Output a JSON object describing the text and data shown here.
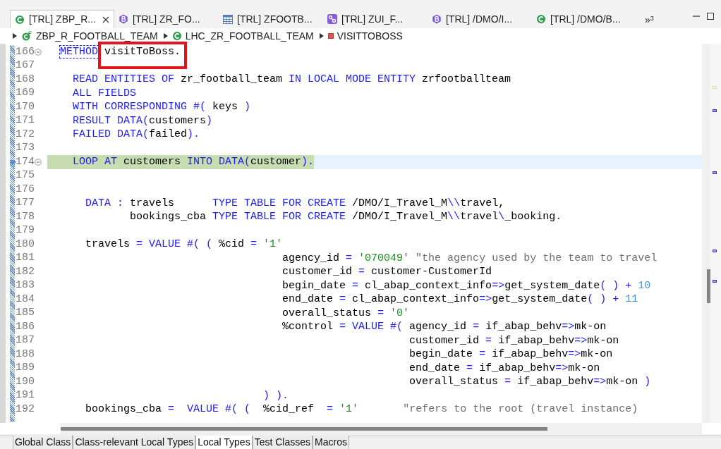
{
  "editor_tabs": [
    {
      "kind": "class",
      "label": "[TRL] ZBP_R...",
      "selected": true
    },
    {
      "kind": "behavior",
      "label": "[TRL] ZR_FO...",
      "selected": false
    },
    {
      "kind": "table",
      "label": "[TRL] ZFOOTB...",
      "selected": false
    },
    {
      "kind": "service",
      "label": "[TRL] ZUI_F...",
      "selected": false
    },
    {
      "kind": "behavior",
      "label": "[TRL] /DMO/I...",
      "selected": false
    },
    {
      "kind": "class",
      "label": "[TRL] /DMO/B...",
      "selected": false
    }
  ],
  "overflow": {
    "symbol": "»",
    "count": "3"
  },
  "breadcrumb": [
    {
      "kind": "global-class",
      "label": "ZBP_R_FOOTBALL_TEAM"
    },
    {
      "kind": "class",
      "label": "LHC_ZR_FOOTBALL_TEAM"
    },
    {
      "kind": "method",
      "label": "VISITTOBOSS"
    }
  ],
  "code_lines": [
    {
      "number": "166",
      "foldable": true,
      "current": false,
      "tokens": [
        {
          "kind": "matched",
          "text": "METHOD"
        },
        {
          "kind": "text",
          "text": " visitToBoss."
        }
      ]
    },
    {
      "number": "167",
      "foldable": false,
      "current": false
    },
    {
      "number": "168",
      "foldable": false,
      "current": false,
      "tokens": [
        {
          "kind": "keyword",
          "text": "    READ ENTITIES OF"
        },
        {
          "kind": "text",
          "text": " zr_football_team "
        },
        {
          "kind": "keyword",
          "text": "IN LOCAL MODE ENTITY"
        },
        {
          "kind": "text",
          "text": " zrfootballteam"
        }
      ]
    },
    {
      "number": "169",
      "foldable": false,
      "current": false,
      "tokens": [
        {
          "kind": "keyword",
          "text": "    ALL FIELDS"
        }
      ]
    },
    {
      "number": "170",
      "foldable": false,
      "current": false,
      "tokens": [
        {
          "kind": "keyword",
          "text": "    WITH CORRESPONDING #("
        },
        {
          "kind": "text",
          "text": " keys "
        },
        {
          "kind": "keyword",
          "text": ")"
        }
      ]
    },
    {
      "number": "171",
      "foldable": false,
      "current": false,
      "tokens": [
        {
          "kind": "keyword",
          "text": "    RESULT DATA("
        },
        {
          "kind": "text",
          "text": "customers"
        },
        {
          "kind": "keyword",
          "text": ")"
        }
      ]
    },
    {
      "number": "172",
      "foldable": false,
      "current": false,
      "tokens": [
        {
          "kind": "keyword",
          "text": "    FAILED DATA("
        },
        {
          "kind": "text",
          "text": "failed"
        },
        {
          "kind": "keyword",
          "text": ")."
        }
      ]
    },
    {
      "number": "173",
      "foldable": false,
      "current": false
    },
    {
      "number": "174",
      "foldable": true,
      "current": true,
      "tokens": [
        {
          "kind": "keyword",
          "text": "    LOOP AT"
        },
        {
          "kind": "text",
          "text": " customers "
        },
        {
          "kind": "keyword",
          "text": "INTO DATA("
        },
        {
          "kind": "text",
          "text": "customer"
        },
        {
          "kind": "keyword",
          "text": ")."
        }
      ]
    },
    {
      "number": "175",
      "foldable": false,
      "current": false
    },
    {
      "number": "176",
      "foldable": false,
      "current": false
    },
    {
      "number": "177",
      "foldable": false,
      "current": false,
      "tokens": [
        {
          "kind": "keyword",
          "text": "      DATA :"
        },
        {
          "kind": "text",
          "text": " travels      "
        },
        {
          "kind": "keyword",
          "text": "TYPE TABLE FOR CREATE"
        },
        {
          "kind": "text",
          "text": " /DMO/I_Travel_M"
        },
        {
          "kind": "keyword",
          "text": "\\\\"
        },
        {
          "kind": "text",
          "text": "travel,"
        }
      ]
    },
    {
      "number": "178",
      "foldable": false,
      "current": false,
      "tokens": [
        {
          "kind": "text",
          "text": "             bookings_cba "
        },
        {
          "kind": "keyword",
          "text": "TYPE TABLE FOR CREATE"
        },
        {
          "kind": "text",
          "text": " /DMO/I_Travel_M"
        },
        {
          "kind": "keyword",
          "text": "\\\\"
        },
        {
          "kind": "text",
          "text": "travel"
        },
        {
          "kind": "keyword",
          "text": "\\"
        },
        {
          "kind": "text",
          "text": "_booking"
        },
        {
          "kind": "keyword",
          "text": "."
        }
      ]
    },
    {
      "number": "179",
      "foldable": false,
      "current": false
    },
    {
      "number": "180",
      "foldable": false,
      "current": false,
      "tokens": [
        {
          "kind": "text",
          "text": "      travels "
        },
        {
          "kind": "keyword",
          "text": "= VALUE #( ("
        },
        {
          "kind": "text",
          "text": " %cid "
        },
        {
          "kind": "keyword",
          "text": "="
        },
        {
          "kind": "string",
          "text": " '1'"
        }
      ]
    },
    {
      "number": "181",
      "foldable": false,
      "current": false,
      "tokens": [
        {
          "kind": "text",
          "text": "                                     agency_id "
        },
        {
          "kind": "keyword",
          "text": "="
        },
        {
          "kind": "string",
          "text": " '070049'"
        },
        {
          "kind": "comment",
          "text": " \"the agency used by the team to travel"
        }
      ]
    },
    {
      "number": "182",
      "foldable": false,
      "current": false,
      "tokens": [
        {
          "kind": "text",
          "text": "                                     customer_id "
        },
        {
          "kind": "keyword",
          "text": "="
        },
        {
          "kind": "text",
          "text": " customer-CustomerId"
        }
      ]
    },
    {
      "number": "183",
      "foldable": false,
      "current": false,
      "tokens": [
        {
          "kind": "text",
          "text": "                                     begin_date "
        },
        {
          "kind": "keyword",
          "text": "="
        },
        {
          "kind": "text",
          "text": " cl_abap_context_info"
        },
        {
          "kind": "keyword",
          "text": "=>"
        },
        {
          "kind": "text",
          "text": "get_system_date"
        },
        {
          "kind": "keyword",
          "text": "( ) +"
        },
        {
          "kind": "number",
          "text": " 10"
        }
      ]
    },
    {
      "number": "184",
      "foldable": false,
      "current": false,
      "tokens": [
        {
          "kind": "text",
          "text": "                                     end_date "
        },
        {
          "kind": "keyword",
          "text": "="
        },
        {
          "kind": "text",
          "text": " cl_abap_context_info"
        },
        {
          "kind": "keyword",
          "text": "=>"
        },
        {
          "kind": "text",
          "text": "get_system_date"
        },
        {
          "kind": "keyword",
          "text": "( ) +"
        },
        {
          "kind": "number",
          "text": " 11"
        }
      ]
    },
    {
      "number": "185",
      "foldable": false,
      "current": false,
      "tokens": [
        {
          "kind": "text",
          "text": "                                     overall_status "
        },
        {
          "kind": "keyword",
          "text": "="
        },
        {
          "kind": "string",
          "text": " '0'"
        }
      ]
    },
    {
      "number": "186",
      "foldable": false,
      "current": false,
      "tokens": [
        {
          "kind": "text",
          "text": "                                     %control "
        },
        {
          "kind": "keyword",
          "text": "= VALUE #("
        },
        {
          "kind": "text",
          "text": " agency_id "
        },
        {
          "kind": "keyword",
          "text": "="
        },
        {
          "kind": "text",
          "text": " if_abap_behv"
        },
        {
          "kind": "keyword",
          "text": "=>"
        },
        {
          "kind": "text",
          "text": "mk-on"
        }
      ]
    },
    {
      "number": "187",
      "foldable": false,
      "current": false,
      "tokens": [
        {
          "kind": "text",
          "text": "                                                         customer_id "
        },
        {
          "kind": "keyword",
          "text": "="
        },
        {
          "kind": "text",
          "text": " if_abap_behv"
        },
        {
          "kind": "keyword",
          "text": "=>"
        },
        {
          "kind": "text",
          "text": "mk-on"
        }
      ]
    },
    {
      "number": "188",
      "foldable": false,
      "current": false,
      "tokens": [
        {
          "kind": "text",
          "text": "                                                         begin_date "
        },
        {
          "kind": "keyword",
          "text": "="
        },
        {
          "kind": "text",
          "text": " if_abap_behv"
        },
        {
          "kind": "keyword",
          "text": "=>"
        },
        {
          "kind": "text",
          "text": "mk-on"
        }
      ]
    },
    {
      "number": "189",
      "foldable": false,
      "current": false,
      "tokens": [
        {
          "kind": "text",
          "text": "                                                         end_date "
        },
        {
          "kind": "keyword",
          "text": "="
        },
        {
          "kind": "text",
          "text": " if_abap_behv"
        },
        {
          "kind": "keyword",
          "text": "=>"
        },
        {
          "kind": "text",
          "text": "mk-on"
        }
      ]
    },
    {
      "number": "190",
      "foldable": false,
      "current": false,
      "tokens": [
        {
          "kind": "text",
          "text": "                                                         overall_status "
        },
        {
          "kind": "keyword",
          "text": "="
        },
        {
          "kind": "text",
          "text": " if_abap_behv"
        },
        {
          "kind": "keyword",
          "text": "=>"
        },
        {
          "kind": "text",
          "text": "mk-on"
        },
        {
          "kind": "keyword",
          "text": " )"
        }
      ]
    },
    {
      "number": "191",
      "foldable": false,
      "current": false,
      "tokens": [
        {
          "kind": "keyword",
          "text": "                                  ) )."
        }
      ]
    },
    {
      "number": "192",
      "foldable": false,
      "current": false,
      "tokens": [
        {
          "kind": "text",
          "text": "      bookings_cba "
        },
        {
          "kind": "keyword",
          "text": "=  VALUE #( ("
        },
        {
          "kind": "text",
          "text": "  %cid_ref  "
        },
        {
          "kind": "keyword",
          "text": "="
        },
        {
          "kind": "string",
          "text": " '1'"
        },
        {
          "kind": "comment",
          "text": "       \"refers to the root (travel instance)"
        }
      ]
    }
  ],
  "bottom_tabs": [
    {
      "label": "Global Class",
      "selected": false
    },
    {
      "label": "Class-relevant Local Types",
      "selected": false
    },
    {
      "label": "Local Types",
      "selected": true
    },
    {
      "label": "Test Classes",
      "selected": false
    },
    {
      "label": "Macros",
      "selected": false
    }
  ]
}
